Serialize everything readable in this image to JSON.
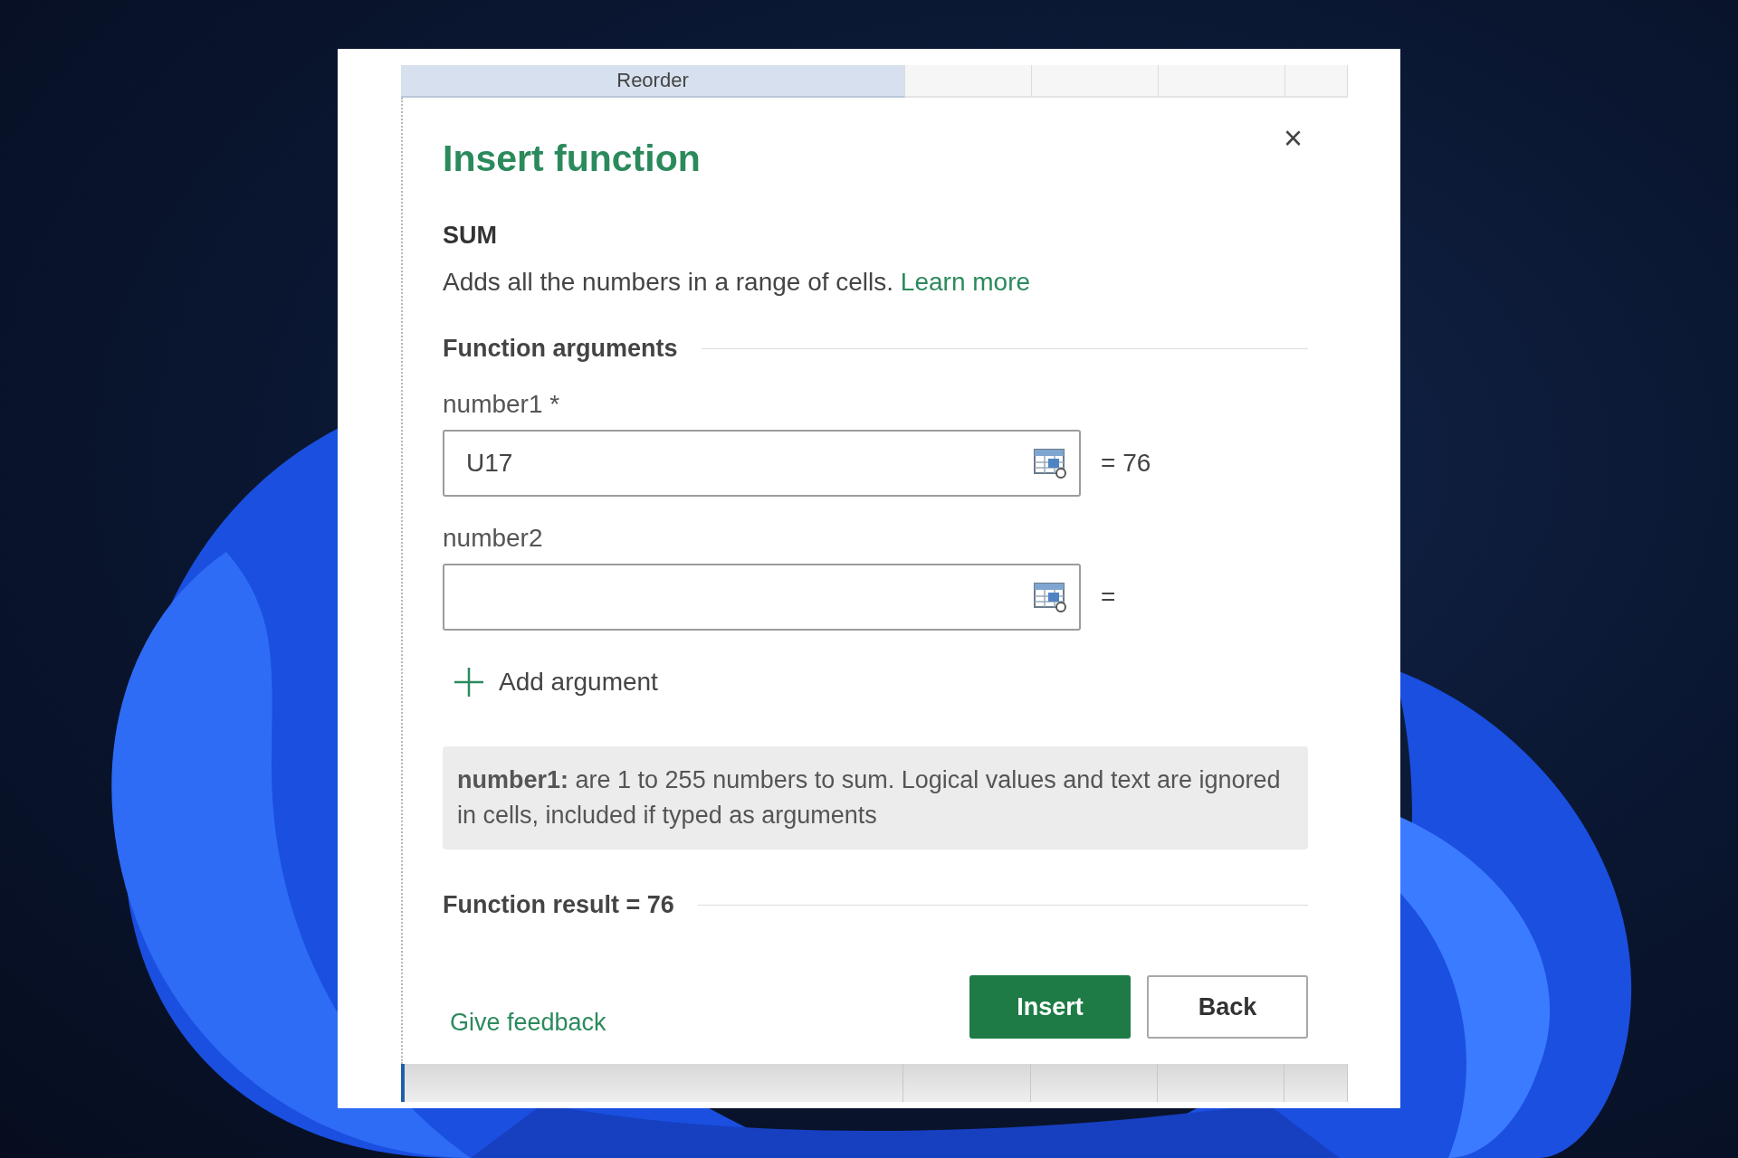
{
  "sheet_header": {
    "cells": [
      "Reorder",
      "",
      "",
      "",
      ""
    ]
  },
  "dialog": {
    "title": "Insert function",
    "close": "×",
    "function_name": "SUM",
    "description": "Adds all the numbers in a range of cells.",
    "learn_more": "Learn more",
    "arguments_heading": "Function arguments",
    "arguments": [
      {
        "label": "number1 *",
        "value": "U17",
        "result": "= 76"
      },
      {
        "label": "number2",
        "result": "="
      }
    ],
    "add_argument": "Add argument",
    "help_text": "**number1:** are 1 to 255 numbers to sum. Logical values and text are ignored in cells, included if typed as arguments",
    "function_result": "Function result = 76",
    "feedback": "Give feedback",
    "buttons": [
      {
        "label": "Insert",
        "kind": "primary"
      },
      {
        "label": "Back",
        "kind": "secondary"
      }
    ]
  }
}
